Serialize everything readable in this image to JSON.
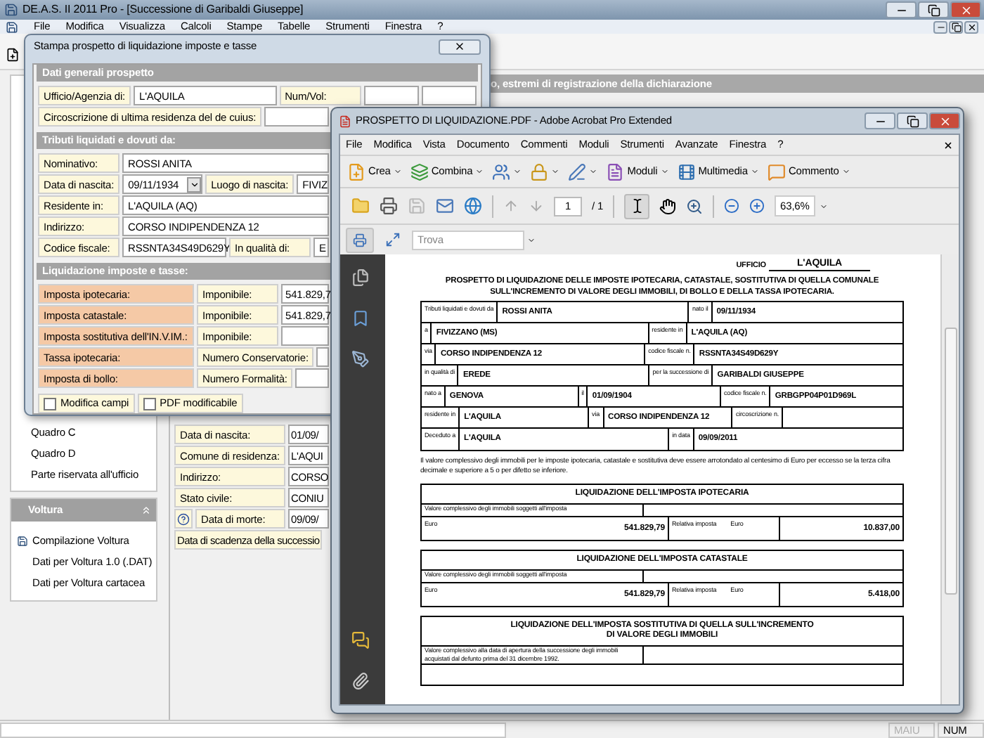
{
  "app": {
    "title": "DE.A.S. II 2011 Pro - [Successione di Garibaldi Giuseppe]",
    "menu": [
      "File",
      "Modifica",
      "Visualizza",
      "Calcoli",
      "Stampe",
      "Tabelle",
      "Strumenti",
      "Finestra",
      "?"
    ]
  },
  "section_header": "o, estremi di registrazione della dichiarazione",
  "sidebar": {
    "items": [
      "Quadro C",
      "Quadro D",
      "Parte riservata all'ufficio"
    ],
    "voltura": {
      "title": "Voltura",
      "expanded": true,
      "items": [
        {
          "label": "Compilazione Voltura",
          "kind": "icon"
        },
        {
          "label": "Dati per Voltura 1.0 (.DAT)",
          "kind": "plain"
        },
        {
          "label": "Dati per Voltura cartacea",
          "kind": "plain"
        }
      ]
    }
  },
  "deceased_fields": [
    {
      "kind": "field",
      "label": "Data di nascita:",
      "value": "01/09/"
    },
    {
      "kind": "field",
      "label": "Comune di residenza:",
      "value": "L'AQUI"
    },
    {
      "kind": "field",
      "label": "Indirizzo:",
      "value": "CORSO"
    },
    {
      "kind": "field",
      "label": "Stato civile:",
      "value": "CONIU"
    },
    {
      "kind": "help",
      "label": "Data di morte:",
      "value": "09/09/"
    },
    {
      "kind": "wide",
      "label": "Data di scadenza della successio"
    }
  ],
  "status_bar": [
    {
      "text": "MAIU",
      "disabled": true
    },
    {
      "text": "NUM",
      "disabled": false
    }
  ],
  "dialog": {
    "title": "Stampa prospetto di liquidazione imposte e tasse",
    "sections": [
      {
        "title": "Dati generali prospetto",
        "rows": [
          [
            {
              "kind": "label",
              "text": "Ufficio/Agenzia di:"
            },
            {
              "kind": "input",
              "value": "L'AQUILA"
            },
            {
              "kind": "label",
              "text": "Num/Vol:"
            },
            {
              "kind": "input"
            },
            {
              "kind": "input"
            }
          ],
          [
            {
              "kind": "label",
              "text": "Circoscrizione di ultima residenza del de cuius:"
            },
            {
              "kind": "input"
            }
          ]
        ]
      },
      {
        "title": "Tributi liquidati e dovuti da:",
        "rows": [
          [
            {
              "kind": "label",
              "text": "Nominativo:"
            },
            {
              "kind": "input",
              "value": "ROSSI ANITA"
            }
          ],
          [
            {
              "kind": "label",
              "text": "Data di nascita:"
            },
            {
              "kind": "date",
              "value": "09/11/1934"
            },
            {
              "kind": "label",
              "text": "Luogo di nascita:"
            },
            {
              "kind": "input",
              "value": "FIVIZ"
            }
          ],
          [
            {
              "kind": "label",
              "text": "Residente in:"
            },
            {
              "kind": "input",
              "value": "L'AQUILA (AQ)"
            }
          ],
          [
            {
              "kind": "label",
              "text": "Indirizzo:"
            },
            {
              "kind": "input",
              "value": "CORSO INDIPENDENZA 12"
            }
          ],
          [
            {
              "kind": "label",
              "text": "Codice fiscale:"
            },
            {
              "kind": "code",
              "value": "RSSNTA34S49D629Y"
            },
            {
              "kind": "label",
              "text": "In qualità di:"
            },
            {
              "kind": "input",
              "value": "E"
            }
          ]
        ]
      },
      {
        "title": "Liquidazione imposte e tasse:",
        "rows": [
          [
            {
              "kind": "tax_label",
              "text": "Imposta ipotecaria:"
            },
            {
              "kind": "label",
              "text": "Imponibile:"
            },
            {
              "kind": "amount",
              "value": "541.829,7"
            }
          ],
          [
            {
              "kind": "tax_label",
              "text": "Imposta catastale:"
            },
            {
              "kind": "label",
              "text": "Imponibile:"
            },
            {
              "kind": "amount",
              "value": "541.829,7"
            }
          ],
          [
            {
              "kind": "tax_label",
              "text": "Imposta sostitutiva dell'IN.V.IM.:"
            },
            {
              "kind": "label",
              "text": "Imponibile:"
            },
            {
              "kind": "input"
            }
          ],
          [
            {
              "kind": "tax_label",
              "text": "Tassa ipotecaria:"
            },
            {
              "kind": "label",
              "text": "Numero Conservatorie:"
            },
            {
              "kind": "input"
            }
          ],
          [
            {
              "kind": "tax_label",
              "text": "Imposta di bollo:"
            },
            {
              "kind": "label",
              "text": "Numero Formalità:"
            },
            {
              "kind": "input"
            }
          ]
        ]
      }
    ],
    "options": [
      {
        "label": "Modifica campi",
        "checked": false
      },
      {
        "label": "PDF modificabile",
        "checked": false
      }
    ]
  },
  "pdf": {
    "title": "PROSPETTO DI LIQUIDAZIONE.PDF - Adobe Acrobat Pro Extended",
    "menu": [
      "File",
      "Modifica",
      "Vista",
      "Documento",
      "Commenti",
      "Moduli",
      "Strumenti",
      "Avanzate",
      "Finestra",
      "?"
    ],
    "toolbar": [
      {
        "kind": "labeled",
        "label": "Crea"
      },
      {
        "kind": "labeled",
        "label": "Combina"
      },
      {
        "kind": "icon"
      },
      {
        "kind": "icon"
      },
      {
        "kind": "icon"
      },
      {
        "kind": "labeled",
        "label": "Moduli"
      },
      {
        "kind": "labeled",
        "label": "Multimedia"
      },
      {
        "kind": "labeled",
        "label": "Commento"
      }
    ],
    "page": {
      "current": "1",
      "total": "/ 1"
    },
    "zoom": "63,6%",
    "search": {
      "placeholder": "Trova"
    },
    "document": {
      "office_label": "UFFICIO",
      "office": "L'AQUILA",
      "heading": "PROSPETTO DI LIQUIDAZIONE DELLE IMPOSTE IPOTECARIA, CATASTALE, SOSTITUTIVA DI QUELLA COMUNALE SULL'INCREMENTO DI VALORE DEGLI IMMOBILI, DI BOLLO E DELLA TASSA IPOTECARIA.",
      "table": [
        [
          {
            "kind": "label",
            "text": "Tributi liquidati e dovuti da"
          },
          {
            "kind": "value",
            "text": "ROSSI ANITA"
          },
          {
            "kind": "label",
            "text": "nato il"
          },
          {
            "kind": "value",
            "text": "09/11/1934"
          }
        ],
        [
          {
            "kind": "label",
            "text": "a"
          },
          {
            "kind": "value",
            "text": "FIVIZZANO (MS)"
          },
          {
            "kind": "label",
            "text": "residente in"
          },
          {
            "kind": "value",
            "text": "L'AQUILA (AQ)"
          }
        ],
        [
          {
            "kind": "label",
            "text": "via"
          },
          {
            "kind": "value",
            "text": "CORSO INDIPENDENZA 12"
          },
          {
            "kind": "label",
            "text": "codice fiscale n."
          },
          {
            "kind": "value",
            "text": "RSSNTA34S49D629Y"
          }
        ],
        [
          {
            "kind": "label",
            "text": "in qualità di"
          },
          {
            "kind": "value",
            "text": "EREDE"
          },
          {
            "kind": "label",
            "text": "per la successione di"
          },
          {
            "kind": "value",
            "text": "GARIBALDI GIUSEPPE"
          }
        ],
        [
          {
            "kind": "label",
            "text": "nato a"
          },
          {
            "kind": "value",
            "text": "GENOVA"
          },
          {
            "kind": "label",
            "text": "il"
          },
          {
            "kind": "value",
            "text": "01/09/1904"
          },
          {
            "kind": "label",
            "text": "codice fiscale n."
          },
          {
            "kind": "value",
            "text": "GRBGPP04P01D969L"
          }
        ],
        [
          {
            "kind": "label",
            "text": "residente in"
          },
          {
            "kind": "value",
            "text": "L'AQUILA"
          },
          {
            "kind": "label",
            "text": "via"
          },
          {
            "kind": "value",
            "text": "CORSO INDIPENDENZA 12"
          },
          {
            "kind": "label",
            "text": "circoscrizione n."
          },
          {
            "kind": "value"
          }
        ],
        [
          {
            "kind": "label",
            "text": "Deceduto a"
          },
          {
            "kind": "value",
            "text": "L'AQUILA"
          },
          {
            "kind": "label",
            "text": "in data"
          },
          {
            "kind": "value",
            "text": "09/09/2011"
          }
        ]
      ],
      "note": "Il valore complessivo degli immobili per le imposte ipotecaria, catastale e sostitutiva deve essere arrotondato al centesimo di Euro per eccesso se la terza cifra decimale e superiore a 5 o per difetto se inferiore.",
      "sections": [
        {
          "title": "LIQUIDAZIONE DELL'IMPOSTA IPOTECARIA",
          "value_label": "Valore complessivo degli immobili soggetti all'imposta",
          "currency": "Euro",
          "amount": "541.829,79",
          "tax_label": "Relativa imposta",
          "tax_currency": "Euro",
          "tax": "10.837,00"
        },
        {
          "title": "LIQUIDAZIONE DELL'IMPOSTA CATASTALE",
          "value_label": "Valore complessivo degli immobili soggetti all'imposta",
          "currency": "Euro",
          "amount": "541.829,79",
          "tax_label": "Relativa imposta",
          "tax_currency": "Euro",
          "tax": "5.418,00"
        },
        {
          "title": "LIQUIDAZIONE DELL'IMPOSTA SOSTITUTIVA DI QUELLA SULL'INCREMENTO DI VALORE DEGLI IMMOBILI",
          "value_label": "Valore complessivo alla data di apertura della successione degli immobili acquistati dal defunto prima del 31 dicembre 1992."
        }
      ]
    }
  }
}
